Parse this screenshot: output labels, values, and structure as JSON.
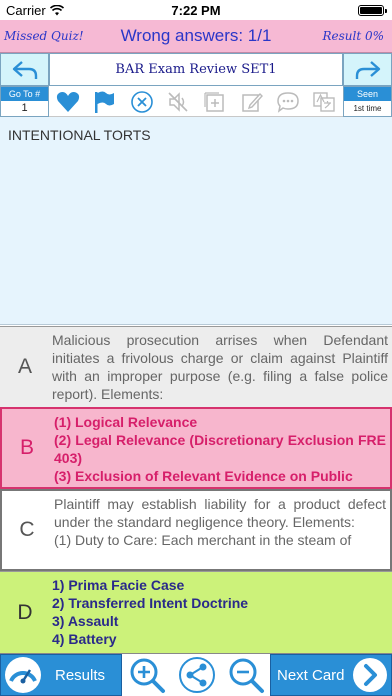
{
  "status": {
    "carrier": "Carrier",
    "time": "7:22 PM"
  },
  "header": {
    "missed_label": "Missed Quiz!",
    "wrong_answers": "Wrong answers: 1/1",
    "result_label": "Result 0%"
  },
  "nav": {
    "title": "BAR Exam Review SET1"
  },
  "toolbar": {
    "goto_label": "Go To #",
    "goto_value": "1",
    "seen_label": "Seen",
    "seen_value": "1st time",
    "icons": [
      "heart-icon",
      "flag-icon",
      "close-circle-icon",
      "mute-icon",
      "add-icon",
      "edit-icon",
      "comment-icon",
      "translate-icon"
    ]
  },
  "question": {
    "text": "INTENTIONAL TORTS"
  },
  "answers": [
    {
      "letter": "A",
      "text": "Malicious prosecution arrises when Defendant initiates a frivolous charge or claim against Plaintiff with an improper purpose (e.g. filing a false police report). Elements:"
    },
    {
      "letter": "B",
      "lines": [
        "(1) Logical Relevance",
        "(2) Legal Relevance (Discretionary Exclusion FRE 403)",
        "(3) Exclusion of Relevant Evidence on Public"
      ]
    },
    {
      "letter": "C",
      "text": "Plaintiff may establish liability for a product defect under the standard negligence theory. Elements:",
      "extra": "(1) Duty to Care: Each merchant in the steam of"
    },
    {
      "letter": "D",
      "lines": [
        "1) Prima Facie Case",
        "2) Transferred Intent Doctrine",
        "3) Assault",
        "4) Battery"
      ]
    }
  ],
  "bottom": {
    "results_label": "Results",
    "next_label": "Next Card"
  },
  "colors": {
    "accent_blue": "#2a8fd6",
    "pink": "#f6b9d4",
    "green": "#ccf27a",
    "question_bg": "#e6f4fd"
  }
}
